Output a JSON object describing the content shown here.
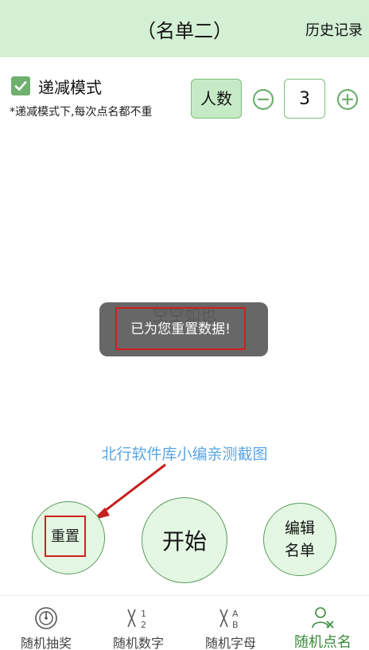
{
  "header": {
    "title": "（名单二）",
    "history_label": "历史记录"
  },
  "mode": {
    "label": "递减模式",
    "checked": true,
    "hint": "*递减模式下,每次点名都不重"
  },
  "count": {
    "label": "人数",
    "value": "3"
  },
  "main": {
    "empty_text": "空空如也",
    "toast_text": "已为您重置数据!"
  },
  "watermark": "北行软件库小编亲测截图",
  "buttons": {
    "reset": "重置",
    "start": "开始",
    "edit_line1": "编辑",
    "edit_line2": "名单"
  },
  "tabs": [
    {
      "label": "随机抽奖",
      "icon": "wheel-icon"
    },
    {
      "label": "随机数字",
      "icon": "number-icon"
    },
    {
      "label": "随机字母",
      "icon": "letter-icon"
    },
    {
      "label": "随机点名",
      "icon": "person-icon",
      "active": true
    }
  ],
  "colors": {
    "accent": "#6fb06f",
    "header_bg": "#d3efd4",
    "button_bg": "#e3f7e3",
    "highlight": "#d01f1f",
    "watermark": "#5aa6e6"
  }
}
